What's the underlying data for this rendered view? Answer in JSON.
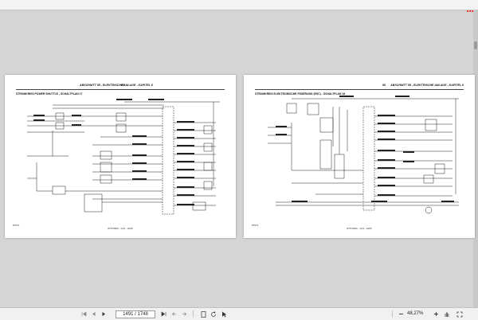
{
  "viewer": {
    "page_indicator": "1491 / 1748",
    "zoom": "48,27%",
    "accent_color": "#e23a2c"
  },
  "toolbar": {
    "icons": [
      "first-page-icon",
      "prev-page-icon",
      "next-page-icon",
      "last-page-icon",
      "prev-view-icon",
      "next-view-icon",
      "fit-page-icon",
      "rotate-icon",
      "select-icon",
      "zoom-out-icon",
      "zoom-in-icon",
      "hand-icon",
      "fullscreen-icon"
    ]
  },
  "pages": {
    "left": {
      "header_chapter": "ABSCHNITT 55 - ELEKTRISCHE ANLAGE - KAPITEL 6",
      "header_number": "55",
      "title": "STROMKREIS POWER SHUTTLE - SCHALTPLAN 17",
      "footer_id": "87572",
      "footer_center": "87575606 - 10/1 - 2005"
    },
    "right": {
      "header_number": "56",
      "header_chapter": "ABSCHNITT 55 - ELEKTRISCHE ANLAGE - KAPITEL 6",
      "title": "STROMKREIS ELEKTRONISCHE FEDERUNG (ESC) - SCHALTPLAN 18",
      "footer_id": "87572",
      "footer_center": "87575606 - 10/1 - 2005"
    }
  }
}
